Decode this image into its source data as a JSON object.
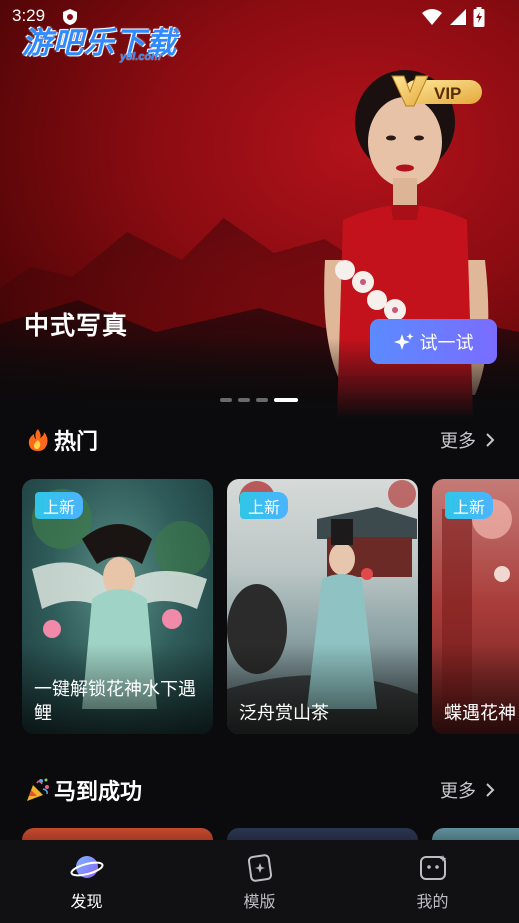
{
  "status_bar": {
    "time": "3:29"
  },
  "watermark": {
    "main": "游吧乐下载",
    "sub": "y8l.com"
  },
  "banner": {
    "badge": "VIP",
    "title": "中式写真",
    "try_button": "试一试",
    "page_count": 4,
    "active_page": 4
  },
  "hot_section": {
    "title": "热门",
    "emoji": "🔥",
    "more_label": "更多",
    "cards": [
      {
        "tag": "上新",
        "title": "一键解锁花神水下遇鲤"
      },
      {
        "tag": "上新",
        "title": "泛舟赏山茶"
      },
      {
        "tag": "上新",
        "title": "蝶遇花神"
      }
    ]
  },
  "success_section": {
    "title": "马到成功",
    "emoji": "🎉",
    "more_label": "更多"
  },
  "bottom_nav": {
    "items": [
      {
        "label": "发现",
        "icon": "planet-icon",
        "active": true
      },
      {
        "label": "模版",
        "icon": "template-icon",
        "active": false
      },
      {
        "label": "我的",
        "icon": "profile-icon",
        "active": false
      }
    ]
  },
  "colors": {
    "accent_gradient_start": "#5b8bff",
    "accent_gradient_end": "#7a6cff",
    "tag_color": "#2fc6e6",
    "background": "#0b0b0d"
  }
}
